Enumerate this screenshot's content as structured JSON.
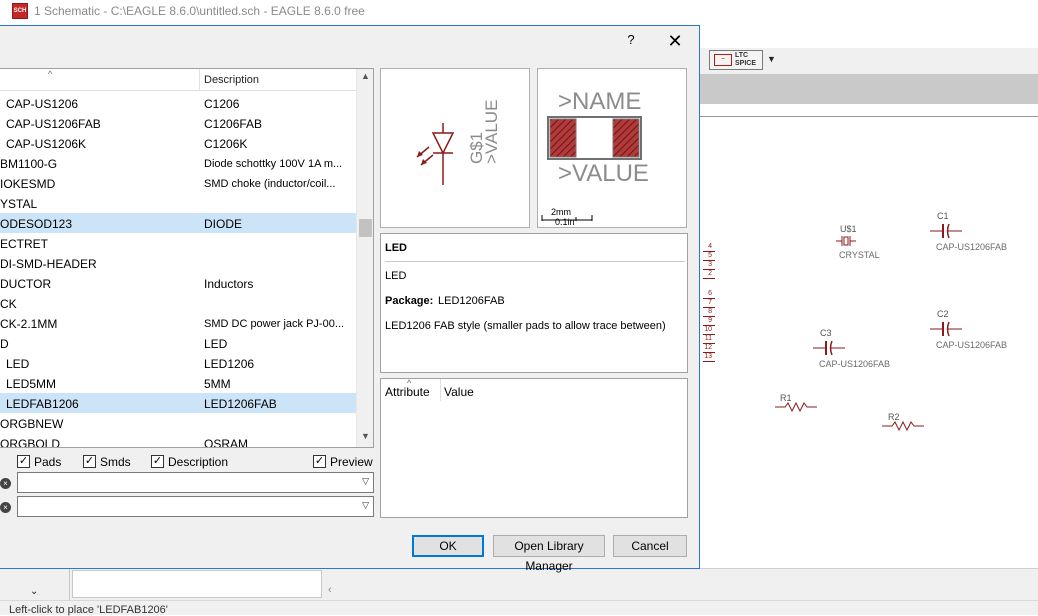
{
  "app": {
    "title": "1 Schematic - C:\\EAGLE 8.6.0\\untitled.sch - EAGLE 8.6.0 free",
    "icon_label": "SCH",
    "spice_logo": "~",
    "spice_label": "LTC SPICE",
    "status_text": "Left-click to place 'LEDFAB1206'"
  },
  "schematic": {
    "pin_numbers": [
      "4",
      "5",
      "3",
      "2",
      "6",
      "7",
      "8",
      "9",
      "10",
      "11",
      "12",
      "13"
    ],
    "parts": [
      {
        "ref": "U$1",
        "value": "CRYSTAL"
      },
      {
        "ref": "C1",
        "value": "CAP-US1206FAB"
      },
      {
        "ref": "C2",
        "value": "CAP-US1206FAB"
      },
      {
        "ref": "C3",
        "value": "CAP-US1206FAB"
      },
      {
        "ref": "R1",
        "value": ""
      },
      {
        "ref": "R2",
        "value": ""
      }
    ]
  },
  "dialog": {
    "help": "?",
    "close": "✕",
    "list": {
      "col_description": "Description",
      "rows": [
        {
          "name": "CAP-US1206",
          "desc": "C1206",
          "indent": true
        },
        {
          "name": "CAP-US1206FAB",
          "desc": "C1206FAB",
          "indent": true
        },
        {
          "name": "CAP-US1206K",
          "desc": "C1206K",
          "indent": true
        },
        {
          "name": "BM1100-G",
          "desc": "Diode schottky 100V 1A m...",
          "indent": false
        },
        {
          "name": "IOKESMD",
          "desc": "SMD choke (inductor/coil...",
          "indent": false
        },
        {
          "name": "YSTAL",
          "desc": "",
          "indent": false
        },
        {
          "name": "ODESOD123",
          "desc": "DIODE",
          "indent": false,
          "selected": true
        },
        {
          "name": "ECTRET",
          "desc": "",
          "indent": false
        },
        {
          "name": "DI-SMD-HEADER",
          "desc": "",
          "indent": false
        },
        {
          "name": "DUCTOR",
          "desc": "Inductors",
          "indent": false
        },
        {
          "name": "CK",
          "desc": "",
          "indent": false
        },
        {
          "name": "CK-2.1MM",
          "desc": "SMD DC power jack PJ-00...",
          "indent": false
        },
        {
          "name": "D",
          "desc": "LED",
          "indent": false
        },
        {
          "name": "LED",
          "desc": "LED1206",
          "indent": true
        },
        {
          "name": "LED5MM",
          "desc": "5MM",
          "indent": true
        },
        {
          "name": "LEDFAB1206",
          "desc": "LED1206FAB",
          "indent": true,
          "selected": true
        },
        {
          "name": "ORGBNEW",
          "desc": "",
          "indent": false
        },
        {
          "name": "ORGBOLD",
          "desc": "OSRAM",
          "indent": false
        }
      ]
    },
    "options": {
      "pads": "Pads",
      "smds": "Smds",
      "description": "Description",
      "preview": "Preview",
      "check": "✓"
    },
    "filter1_value": "",
    "filter2_value": "",
    "symbol_preview": {
      "name_text": "G$1",
      "value_text": ">VALUE"
    },
    "package_preview": {
      "name_text": ">NAME",
      "value_text": ">VALUE",
      "scale_mm": "2mm",
      "scale_in": "0.1in"
    },
    "info": {
      "title": "LED",
      "description": "LED",
      "package_label": "Package:",
      "package_value": "LED1206FAB",
      "detail": "LED1206 FAB style (smaller pads to allow trace between)"
    },
    "attributes": {
      "col_attribute": "Attribute",
      "col_value": "Value"
    },
    "buttons": {
      "ok": "OK",
      "library_manager": "Open Library Manager",
      "cancel": "Cancel"
    }
  },
  "colors": {
    "accent": "#0078d7",
    "selection": "#cce4f7",
    "schematic": "#8b1a1a",
    "preview_gray": "#8c8c8c"
  }
}
